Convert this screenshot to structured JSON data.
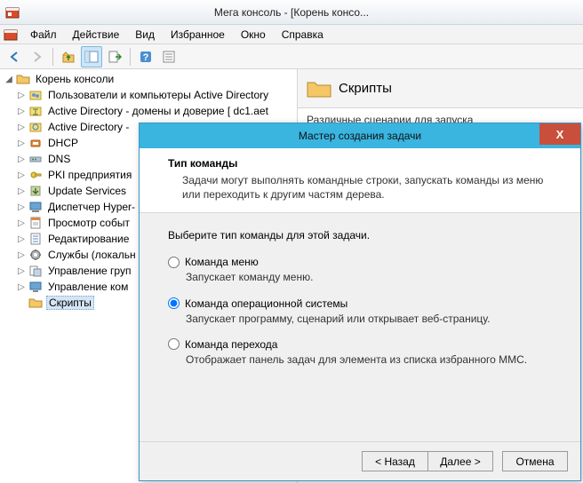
{
  "titlebar": {
    "text": "Мега консоль - [Корень консо..."
  },
  "menu": {
    "items": [
      "Файл",
      "Действие",
      "Вид",
      "Избранное",
      "Окно",
      "Справка"
    ]
  },
  "tree": {
    "root": "Корень консоли",
    "nodes": [
      {
        "label": "Пользователи и компьютеры Active Directory",
        "icon": "ad-users"
      },
      {
        "label": "Active Directory - домены и доверие [ dc1.aet",
        "icon": "ad-domains"
      },
      {
        "label": "Active Directory -",
        "icon": "ad-sites"
      },
      {
        "label": "DHCP",
        "icon": "dhcp"
      },
      {
        "label": "DNS",
        "icon": "dns"
      },
      {
        "label": "PKI предприятия",
        "icon": "pki"
      },
      {
        "label": "Update Services",
        "icon": "update"
      },
      {
        "label": "Диспетчер Hyper-",
        "icon": "hyperv"
      },
      {
        "label": "Просмотр событ",
        "icon": "events"
      },
      {
        "label": "Редактирование",
        "icon": "policy"
      },
      {
        "label": "Службы (локальн",
        "icon": "services"
      },
      {
        "label": "Управление груп",
        "icon": "gpo"
      },
      {
        "label": "Управление ком",
        "icon": "compmgmt"
      },
      {
        "label": "Скрипты",
        "icon": "folder",
        "selected": true
      }
    ]
  },
  "right": {
    "title": "Скрипты",
    "subtitle": "Различные сценарии для запуска"
  },
  "wizard": {
    "title": "Мастер создания задачи",
    "section_title": "Тип команды",
    "section_desc": "Задачи могут выполнять командные строки, запускать команды из меню или переходить к другим частям дерева.",
    "prompt": "Выберите тип команды для этой задачи.",
    "options": [
      {
        "label": "Команда меню",
        "desc": "Запускает команду меню.",
        "checked": false
      },
      {
        "label": "Команда операционной системы",
        "desc": "Запускает программу, сценарий или открывает веб-страницу.",
        "checked": true
      },
      {
        "label": "Команда перехода",
        "desc": "Отображает панель задач для элемента из списка избранного MMC.",
        "checked": false
      }
    ],
    "buttons": {
      "back": "< Назад",
      "next": "Далее >",
      "cancel": "Отмена"
    }
  }
}
